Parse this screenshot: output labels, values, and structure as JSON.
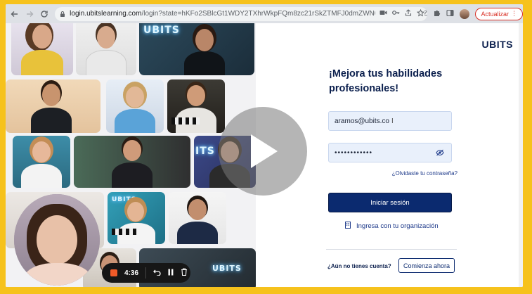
{
  "browser": {
    "url_host": "login.ubitslearning.com",
    "url_rest": "/login?state=hKFo2SBlcGt1WDY2TXhrWkpFQm8zc21rSkZTMFJ0dmZWN0JWNaFupWxvZ2luo3RpZNkgU3BoTTNPWW...",
    "update_label": "Actualizar"
  },
  "login": {
    "logo": "UBITS",
    "heading": "¡Mejora tus habilidades profesionales!",
    "email_value": "aramos@ubits.co",
    "password_value": "••••••••••••",
    "forgot_link": "¿Olvidaste tu contraseña?",
    "signin_label": "Iniciar sesión",
    "org_label": "Ingresa con tu organización",
    "no_account": "¿Aún no tienes cuenta?",
    "start_label": "Comienza ahora"
  },
  "collage": {
    "neon_1": "UBITS",
    "neon_2": "UBITS",
    "neon_3": "ITS",
    "neon_4": "UBITS"
  },
  "recording": {
    "time": "4:36"
  },
  "icons": [
    "back-icon",
    "forward-icon",
    "reload-icon",
    "lock-icon",
    "camera-icon",
    "key-icon",
    "share-icon",
    "star-icon",
    "extensions-icon",
    "sidepanel-icon",
    "profile-avatar",
    "menu-icon",
    "eye-off-icon",
    "building-icon",
    "play-icon",
    "stop-icon",
    "undo-icon",
    "pause-icon",
    "trash-icon"
  ],
  "colors": {
    "frame": "#f6c21c",
    "brand_navy": "#0b2a6f",
    "field_bg": "#e9f0fb",
    "rec_stop": "#f05a28"
  }
}
